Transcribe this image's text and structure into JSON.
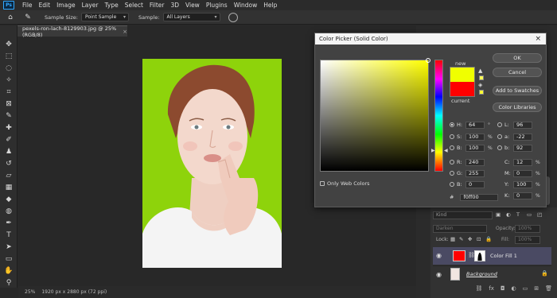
{
  "app": {
    "logo": "Ps"
  },
  "menu": [
    "File",
    "Edit",
    "Image",
    "Layer",
    "Type",
    "Select",
    "Filter",
    "3D",
    "View",
    "Plugins",
    "Window",
    "Help"
  ],
  "options_bar": {
    "sample_size_label": "Sample Size:",
    "sample_size_value": "Point Sample",
    "sample_label": "Sample:",
    "sample_value": "All Layers"
  },
  "document_tab": {
    "title": "pexels-ron-lach-8129903.jpg @ 25% (RGB/8)",
    "close": "×"
  },
  "status_bar": {
    "zoom": "25%",
    "info": "1920 px x 2880 px (72 ppi)"
  },
  "color_picker": {
    "title": "Color Picker (Solid Color)",
    "close": "×",
    "new_label": "new",
    "current_label": "current",
    "new_color": "#f0ff00",
    "current_color": "#ff0000",
    "buttons": {
      "ok": "OK",
      "cancel": "Cancel",
      "add_swatches": "Add to Swatches",
      "color_libraries": "Color Libraries"
    },
    "fields": {
      "H": {
        "value": "64",
        "unit": "°"
      },
      "S": {
        "value": "100",
        "unit": "%"
      },
      "B": {
        "value": "100",
        "unit": "%"
      },
      "R": {
        "value": "240"
      },
      "G": {
        "value": "255"
      },
      "Bl": {
        "value": "0"
      },
      "L": {
        "value": "96"
      },
      "a": {
        "value": "-22"
      },
      "b": {
        "value": "92"
      },
      "C": {
        "value": "12",
        "unit": "%"
      },
      "M": {
        "value": "0",
        "unit": "%"
      },
      "Y": {
        "value": "100",
        "unit": "%"
      },
      "K": {
        "value": "0",
        "unit": "%"
      }
    },
    "only_web_colors": "Only Web Colors",
    "hex_value": "f0ff00"
  },
  "layers_panel": {
    "search_placeholder": "Kind",
    "blend_mode": "Darken",
    "opacity_label": "Opacity:",
    "opacity_value": "100%",
    "lock_label": "Lock:",
    "fill_label": "Fill:",
    "fill_value": "100%",
    "layers": [
      {
        "name": "Color Fill 1"
      },
      {
        "name": "Background"
      }
    ]
  },
  "colors": {
    "photo_bg": "#8ed30b",
    "accent_selected_layer": "#4a4a63"
  }
}
